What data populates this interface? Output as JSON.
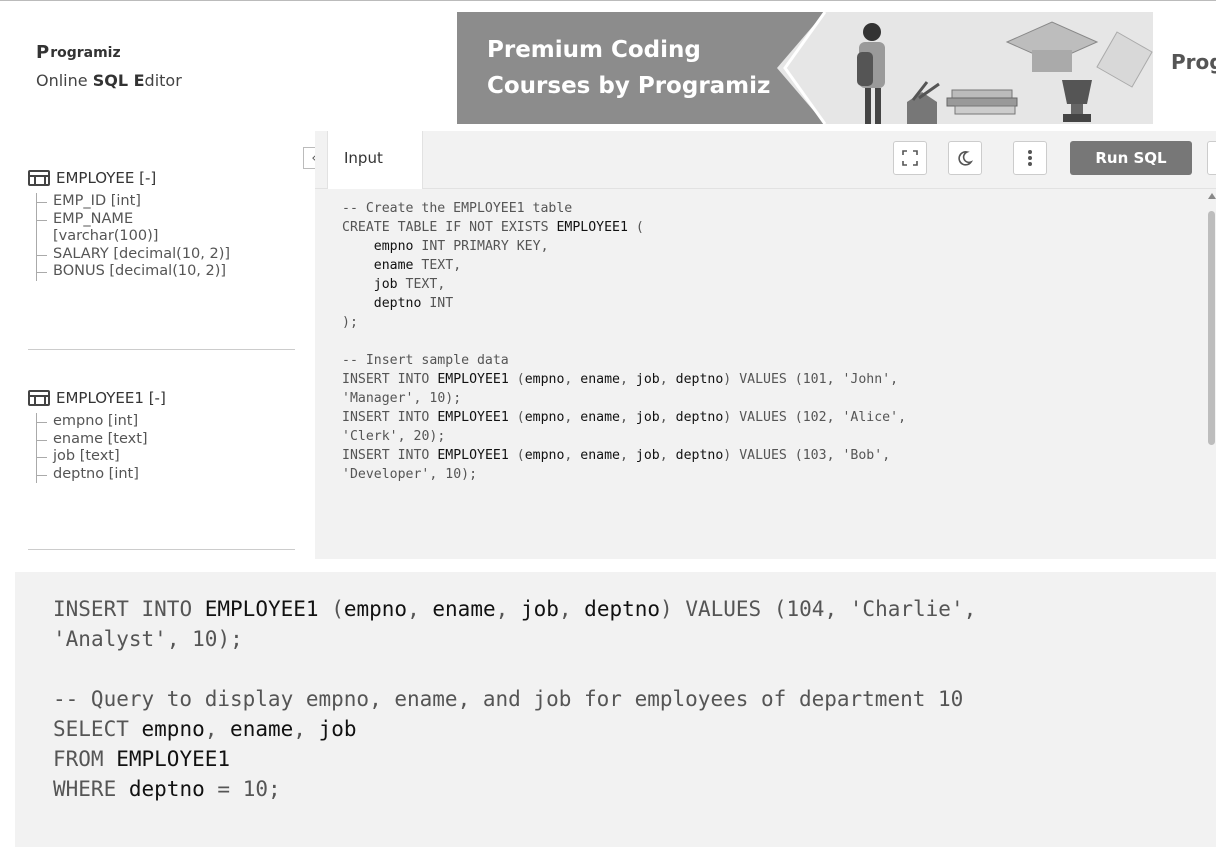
{
  "header": {
    "logo_text": "rogramiz",
    "logo_glyph": "P",
    "subtitle_prefix": "Online ",
    "subtitle_bold_1": "SQL E",
    "subtitle_suffix": "ditor",
    "banner_line1": "Premium Coding",
    "banner_line2": "Courses by Programiz",
    "banner_right_logo": "Prog"
  },
  "sidebar": {
    "tables": [
      {
        "title": "EMPLOYEE [-]",
        "columns": [
          "EMP_ID [int]",
          "EMP_NAME",
          "[varchar(100)]",
          "SALARY [decimal(10, 2)]",
          "BONUS [decimal(10, 2)]"
        ]
      },
      {
        "title": "EMPLOYEE1 [-]",
        "columns": [
          "empno [int]",
          "ename [text]",
          "job [text]",
          "deptno [int]"
        ]
      }
    ],
    "collapse_icon": "‹"
  },
  "toolbar": {
    "tab_label": "Input",
    "fullscreen_icon": "⛶",
    "theme_icon": "☾",
    "menu_icon": "⋮",
    "run_label": "Run SQL"
  },
  "code": {
    "lines": [
      "-- Create the EMPLOYEE1 table",
      "CREATE TABLE IF NOT EXISTS EMPLOYEE1 (",
      "    empno INT PRIMARY KEY,",
      "    ename TEXT,",
      "    job TEXT,",
      "    deptno INT",
      ");",
      "",
      "-- Insert sample data",
      "INSERT INTO EMPLOYEE1 (empno, ename, job, deptno) VALUES (101, 'John',",
      "'Manager', 10);",
      "INSERT INTO EMPLOYEE1 (empno, ename, job, deptno) VALUES (102, 'Alice',",
      "'Clerk', 20);",
      "INSERT INTO EMPLOYEE1 (empno, ename, job, deptno) VALUES (103, 'Bob',",
      "'Developer', 10);"
    ]
  },
  "zoom": {
    "lines": [
      "INSERT INTO EMPLOYEE1 (empno, ename, job, deptno) VALUES (104, 'Charlie',",
      "'Analyst', 10);",
      "",
      "-- Query to display empno, ename, and job for employees of department 10",
      "SELECT empno, ename, job",
      "FROM EMPLOYEE1",
      "WHERE deptno = 10;"
    ]
  },
  "colors": {
    "run_button": "#777777",
    "editor_bg": "#f2f2f2",
    "banner_bg": "#8c8c8c"
  }
}
